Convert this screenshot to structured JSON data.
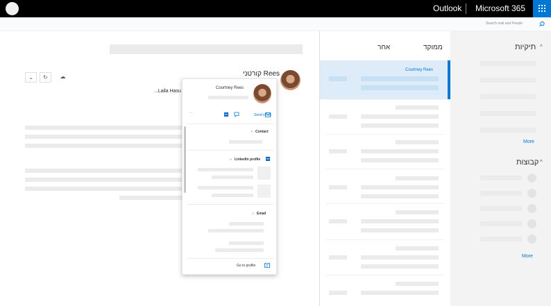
{
  "header": {
    "app_name": "Outlook",
    "suite_name": "Microsoft 365",
    "search_placeholder": "Search mail and People"
  },
  "folders": {
    "favorites_title": "תיקיות",
    "favorites_more": "More",
    "groups_title": "קבוצות",
    "groups_more": "More"
  },
  "message_list": {
    "tabs": [
      "ממוקד",
      "אחר"
    ],
    "selected_sender": "Courtney Rees"
  },
  "reading_pane": {
    "sender_display": "קורטני Rees",
    "to_line": "...Laila Hasu"
  },
  "profile_card": {
    "name": "Courtney Rees",
    "send_email": "Send email",
    "more": "···",
    "contact_section": "Contact",
    "linkedin_section": "LinkedIn profile",
    "email_section": "Email",
    "go_to_profile": "Go to profile"
  },
  "icons": {
    "waffle": "app-launcher-icon",
    "search": "search-icon",
    "reply": "reply-icon",
    "react": "like-icon",
    "more": "chevron-down-icon",
    "chat": "chat-icon",
    "mail": "mail-icon",
    "linkedin": "linkedin-icon"
  },
  "colors": {
    "accent": "#0078d4",
    "topbar": "#000000",
    "selected_row": "#deecf9"
  }
}
